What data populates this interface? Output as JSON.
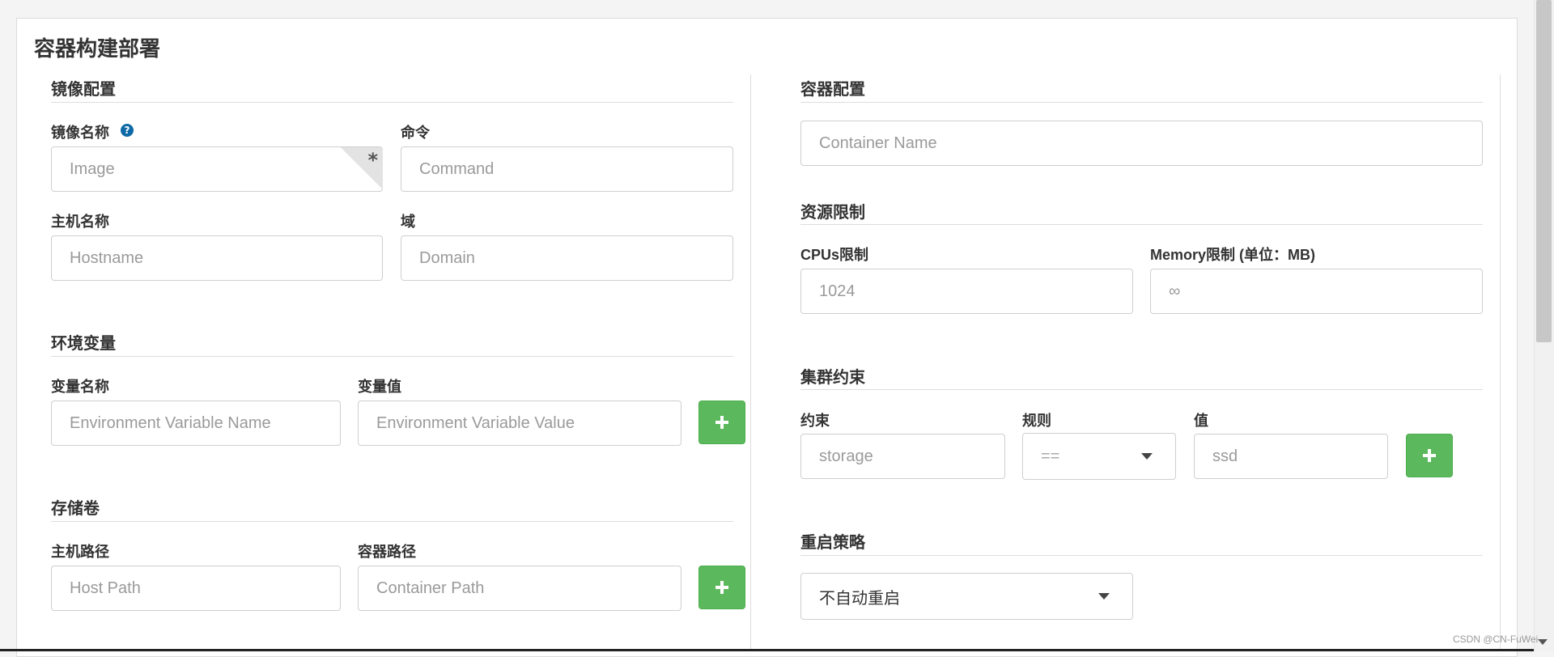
{
  "card": {
    "title": "容器构建部署"
  },
  "image_config": {
    "title": "镜像配置",
    "image_label": "镜像名称",
    "image_placeholder": "Image",
    "image_required_mark": "*",
    "command_label": "命令",
    "command_placeholder": "Command",
    "hostname_label": "主机名称",
    "hostname_placeholder": "Hostname",
    "domain_label": "域",
    "domain_placeholder": "Domain"
  },
  "env": {
    "title": "环境变量",
    "name_label": "变量名称",
    "name_placeholder": "Environment Variable Name",
    "value_label": "变量值",
    "value_placeholder": "Environment Variable Value"
  },
  "volumes": {
    "title": "存储卷",
    "host_label": "主机路径",
    "host_placeholder": "Host Path",
    "container_label": "容器路径",
    "container_placeholder": "Container Path"
  },
  "container_config": {
    "title": "容器配置",
    "name_placeholder": "Container Name"
  },
  "resources": {
    "title": "资源限制",
    "cpu_label": "CPUs限制",
    "cpu_placeholder": "1024",
    "memory_label": "Memory限制 (单位：MB)",
    "memory_placeholder": "∞"
  },
  "constraints": {
    "title": "集群约束",
    "constraint_label": "约束",
    "constraint_placeholder": "storage",
    "rule_label": "规则",
    "rule_value": "==",
    "value_label": "值",
    "value_placeholder": "ssd"
  },
  "restart": {
    "title": "重启策略",
    "selected": "不自动重启"
  },
  "watermark": "CSDN @CN-FuWei",
  "colors": {
    "accent_green": "#5cb85c",
    "help_blue": "#0e6aa6"
  },
  "icons": {
    "add": "plus-icon",
    "help": "question-icon",
    "dropdown": "caret-down-icon"
  }
}
